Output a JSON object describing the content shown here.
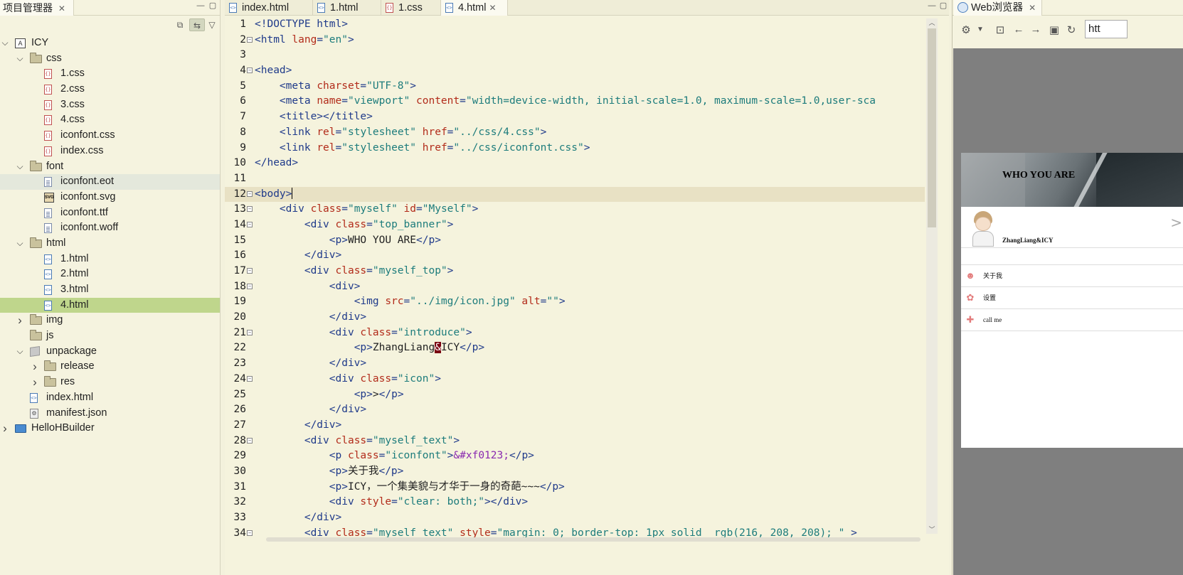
{
  "project_panel": {
    "title": "项目管理器",
    "close": "✕",
    "tree": [
      {
        "label": "ICY",
        "level": 0,
        "type": "project",
        "expanded": true
      },
      {
        "label": "css",
        "level": 1,
        "type": "folder",
        "expanded": true
      },
      {
        "label": "1.css",
        "level": 2,
        "type": "css"
      },
      {
        "label": "2.css",
        "level": 2,
        "type": "css"
      },
      {
        "label": "3.css",
        "level": 2,
        "type": "css"
      },
      {
        "label": "4.css",
        "level": 2,
        "type": "css"
      },
      {
        "label": "iconfont.css",
        "level": 2,
        "type": "css"
      },
      {
        "label": "index.css",
        "level": 2,
        "type": "css"
      },
      {
        "label": "font",
        "level": 1,
        "type": "folder",
        "expanded": true
      },
      {
        "label": "iconfont.eot",
        "level": 2,
        "type": "file",
        "state": "hover"
      },
      {
        "label": "iconfont.svg",
        "level": 2,
        "type": "svg"
      },
      {
        "label": "iconfont.ttf",
        "level": 2,
        "type": "file"
      },
      {
        "label": "iconfont.woff",
        "level": 2,
        "type": "file"
      },
      {
        "label": "html",
        "level": 1,
        "type": "folder",
        "expanded": true
      },
      {
        "label": "1.html",
        "level": 2,
        "type": "html"
      },
      {
        "label": "2.html",
        "level": 2,
        "type": "html"
      },
      {
        "label": "3.html",
        "level": 2,
        "type": "html"
      },
      {
        "label": "4.html",
        "level": 2,
        "type": "html",
        "state": "selected"
      },
      {
        "label": "img",
        "level": 1,
        "type": "folder",
        "expanded": false
      },
      {
        "label": "js",
        "level": 1,
        "type": "folder",
        "leaf": true
      },
      {
        "label": "unpackage",
        "level": 1,
        "type": "package",
        "expanded": true
      },
      {
        "label": "release",
        "level": 2,
        "type": "folder",
        "expanded": false
      },
      {
        "label": "res",
        "level": 2,
        "type": "folder",
        "expanded": false
      },
      {
        "label": "index.html",
        "level": 1,
        "type": "html"
      },
      {
        "label": "manifest.json",
        "level": 1,
        "type": "json"
      },
      {
        "label": "HelloHBuilder",
        "level": 0,
        "type": "project2",
        "expanded": false
      }
    ]
  },
  "editor": {
    "tabs": [
      {
        "label": "index.html",
        "type": "h"
      },
      {
        "label": "1.html",
        "type": "h"
      },
      {
        "label": "1.css",
        "type": "c"
      },
      {
        "label": "4.html",
        "type": "h",
        "active": true
      }
    ],
    "current_line": 12,
    "lines": [
      {
        "n": "1",
        "fold": false,
        "parts": [
          [
            "t-tag",
            "<!DOCTYPE html>"
          ]
        ]
      },
      {
        "n": "2",
        "fold": true,
        "parts": [
          [
            "t-tag",
            "<html "
          ],
          [
            "t-attr",
            "lang"
          ],
          [
            "t-tag",
            "="
          ],
          [
            "t-val",
            "\"en\""
          ],
          [
            "t-tag",
            ">"
          ]
        ]
      },
      {
        "n": "3",
        "fold": false,
        "parts": []
      },
      {
        "n": "4",
        "fold": true,
        "parts": [
          [
            "t-tag",
            "<head>"
          ]
        ]
      },
      {
        "n": "5",
        "fold": false,
        "parts": [
          [
            "t-txt",
            "    "
          ],
          [
            "t-tag",
            "<meta "
          ],
          [
            "t-attr",
            "charset"
          ],
          [
            "t-tag",
            "="
          ],
          [
            "t-val",
            "\"UTF-8\""
          ],
          [
            "t-tag",
            ">"
          ]
        ]
      },
      {
        "n": "6",
        "fold": false,
        "parts": [
          [
            "t-txt",
            "    "
          ],
          [
            "t-tag",
            "<meta "
          ],
          [
            "t-attr",
            "name"
          ],
          [
            "t-tag",
            "="
          ],
          [
            "t-val",
            "\"viewport\" "
          ],
          [
            "t-attr",
            "content"
          ],
          [
            "t-tag",
            "="
          ],
          [
            "t-val",
            "\"width=device-width, initial-scale=1.0, maximum-scale=1.0,user-sca"
          ]
        ]
      },
      {
        "n": "7",
        "fold": false,
        "parts": [
          [
            "t-txt",
            "    "
          ],
          [
            "t-tag",
            "<title></title>"
          ]
        ]
      },
      {
        "n": "8",
        "fold": false,
        "parts": [
          [
            "t-txt",
            "    "
          ],
          [
            "t-tag",
            "<link "
          ],
          [
            "t-attr",
            "rel"
          ],
          [
            "t-tag",
            "="
          ],
          [
            "t-val",
            "\"stylesheet\" "
          ],
          [
            "t-attr",
            "href"
          ],
          [
            "t-tag",
            "="
          ],
          [
            "t-val",
            "\"../css/4.css\""
          ],
          [
            "t-tag",
            ">"
          ]
        ]
      },
      {
        "n": "9",
        "fold": false,
        "parts": [
          [
            "t-txt",
            "    "
          ],
          [
            "t-tag",
            "<link "
          ],
          [
            "t-attr",
            "rel"
          ],
          [
            "t-tag",
            "="
          ],
          [
            "t-val",
            "\"stylesheet\" "
          ],
          [
            "t-attr",
            "href"
          ],
          [
            "t-tag",
            "="
          ],
          [
            "t-val",
            "\"../css/iconfont.css\""
          ],
          [
            "t-tag",
            ">"
          ]
        ]
      },
      {
        "n": "10",
        "fold": false,
        "parts": [
          [
            "t-tag",
            "</head>"
          ]
        ]
      },
      {
        "n": "11",
        "fold": false,
        "parts": []
      },
      {
        "n": "12",
        "fold": true,
        "parts": [
          [
            "t-tag",
            "<body>"
          ]
        ],
        "caret": true
      },
      {
        "n": "13",
        "fold": true,
        "parts": [
          [
            "t-txt",
            "    "
          ],
          [
            "t-tag",
            "<div "
          ],
          [
            "t-attr",
            "class"
          ],
          [
            "t-tag",
            "="
          ],
          [
            "t-val",
            "\"myself\" "
          ],
          [
            "t-attr",
            "id"
          ],
          [
            "t-tag",
            "="
          ],
          [
            "t-val",
            "\"Myself\""
          ],
          [
            "t-tag",
            ">"
          ]
        ]
      },
      {
        "n": "14",
        "fold": true,
        "parts": [
          [
            "t-txt",
            "        "
          ],
          [
            "t-tag",
            "<div "
          ],
          [
            "t-attr",
            "class"
          ],
          [
            "t-tag",
            "="
          ],
          [
            "t-val",
            "\"top_banner\""
          ],
          [
            "t-tag",
            ">"
          ]
        ]
      },
      {
        "n": "15",
        "fold": false,
        "parts": [
          [
            "t-txt",
            "            "
          ],
          [
            "t-tag",
            "<p>"
          ],
          [
            "t-txt",
            "WHO YOU ARE"
          ],
          [
            "t-tag",
            "</p>"
          ]
        ]
      },
      {
        "n": "16",
        "fold": false,
        "parts": [
          [
            "t-txt",
            "        "
          ],
          [
            "t-tag",
            "</div>"
          ]
        ]
      },
      {
        "n": "17",
        "fold": true,
        "parts": [
          [
            "t-txt",
            "        "
          ],
          [
            "t-tag",
            "<div "
          ],
          [
            "t-attr",
            "class"
          ],
          [
            "t-tag",
            "="
          ],
          [
            "t-val",
            "\"myself_top\""
          ],
          [
            "t-tag",
            ">"
          ]
        ]
      },
      {
        "n": "18",
        "fold": true,
        "parts": [
          [
            "t-txt",
            "            "
          ],
          [
            "t-tag",
            "<div>"
          ]
        ]
      },
      {
        "n": "19",
        "fold": false,
        "parts": [
          [
            "t-txt",
            "                "
          ],
          [
            "t-tag",
            "<img "
          ],
          [
            "t-attr",
            "src"
          ],
          [
            "t-tag",
            "="
          ],
          [
            "t-val",
            "\"../img/icon.jpg\" "
          ],
          [
            "t-attr",
            "alt"
          ],
          [
            "t-tag",
            "="
          ],
          [
            "t-val",
            "\"\""
          ],
          [
            "t-tag",
            ">"
          ]
        ]
      },
      {
        "n": "20",
        "fold": false,
        "parts": [
          [
            "t-txt",
            "            "
          ],
          [
            "t-tag",
            "</div>"
          ]
        ]
      },
      {
        "n": "21",
        "fold": true,
        "parts": [
          [
            "t-txt",
            "            "
          ],
          [
            "t-tag",
            "<div "
          ],
          [
            "t-attr",
            "class"
          ],
          [
            "t-tag",
            "="
          ],
          [
            "t-val",
            "\"introduce\""
          ],
          [
            "t-tag",
            ">"
          ]
        ]
      },
      {
        "n": "22",
        "fold": false,
        "parts": [
          [
            "t-txt",
            "                "
          ],
          [
            "t-tag",
            "<p>"
          ],
          [
            "t-txt",
            "ZhangLiang"
          ],
          [
            "t-hl",
            "&"
          ],
          [
            "t-txt",
            "ICY"
          ],
          [
            "t-tag",
            "</p>"
          ]
        ]
      },
      {
        "n": "23",
        "fold": false,
        "parts": [
          [
            "t-txt",
            "            "
          ],
          [
            "t-tag",
            "</div>"
          ]
        ]
      },
      {
        "n": "24",
        "fold": true,
        "parts": [
          [
            "t-txt",
            "            "
          ],
          [
            "t-tag",
            "<div "
          ],
          [
            "t-attr",
            "class"
          ],
          [
            "t-tag",
            "="
          ],
          [
            "t-val",
            "\"icon\""
          ],
          [
            "t-tag",
            ">"
          ]
        ]
      },
      {
        "n": "25",
        "fold": false,
        "parts": [
          [
            "t-txt",
            "                "
          ],
          [
            "t-tag",
            "<p>"
          ],
          [
            "t-txt",
            ">"
          ],
          [
            "t-tag",
            "</p>"
          ]
        ]
      },
      {
        "n": "26",
        "fold": false,
        "parts": [
          [
            "t-txt",
            "            "
          ],
          [
            "t-tag",
            "</div>"
          ]
        ]
      },
      {
        "n": "27",
        "fold": false,
        "parts": [
          [
            "t-txt",
            "        "
          ],
          [
            "t-tag",
            "</div>"
          ]
        ]
      },
      {
        "n": "28",
        "fold": true,
        "parts": [
          [
            "t-txt",
            "        "
          ],
          [
            "t-tag",
            "<div "
          ],
          [
            "t-attr",
            "class"
          ],
          [
            "t-tag",
            "="
          ],
          [
            "t-val",
            "\"myself_text\""
          ],
          [
            "t-tag",
            ">"
          ]
        ]
      },
      {
        "n": "29",
        "fold": false,
        "parts": [
          [
            "t-txt",
            "            "
          ],
          [
            "t-tag",
            "<p "
          ],
          [
            "t-attr",
            "class"
          ],
          [
            "t-tag",
            "="
          ],
          [
            "t-val",
            "\"iconfont\""
          ],
          [
            "t-tag",
            ">"
          ],
          [
            "t-ent",
            "&#xf0123;"
          ],
          [
            "t-tag",
            "</p>"
          ]
        ]
      },
      {
        "n": "30",
        "fold": false,
        "parts": [
          [
            "t-txt",
            "            "
          ],
          [
            "t-tag",
            "<p>"
          ],
          [
            "t-txt",
            "关于我"
          ],
          [
            "t-tag",
            "</p>"
          ]
        ]
      },
      {
        "n": "31",
        "fold": false,
        "parts": [
          [
            "t-txt",
            "            "
          ],
          [
            "t-tag",
            "<p>"
          ],
          [
            "t-txt",
            "ICY，一个集美貌与才华于一身的奇葩~~~"
          ],
          [
            "t-tag",
            "</p>"
          ]
        ]
      },
      {
        "n": "32",
        "fold": false,
        "parts": [
          [
            "t-txt",
            "            "
          ],
          [
            "t-tag",
            "<div "
          ],
          [
            "t-attr",
            "style"
          ],
          [
            "t-tag",
            "="
          ],
          [
            "t-val",
            "\"clear: both;\""
          ],
          [
            "t-tag",
            "></div>"
          ]
        ]
      },
      {
        "n": "33",
        "fold": false,
        "parts": [
          [
            "t-txt",
            "        "
          ],
          [
            "t-tag",
            "</div>"
          ]
        ]
      },
      {
        "n": "34",
        "fold": true,
        "parts": [
          [
            "t-txt",
            "        "
          ],
          [
            "t-tag",
            "<div "
          ],
          [
            "t-attr",
            "class"
          ],
          [
            "t-tag",
            "="
          ],
          [
            "t-val",
            "\"myself_text\" "
          ],
          [
            "t-attr",
            "style"
          ],
          [
            "t-tag",
            "="
          ],
          [
            "t-val",
            "\"margin: 0; border-top: 1px solid  rgb(216, 208, 208); \" "
          ],
          [
            "t-tag",
            ">"
          ]
        ]
      }
    ]
  },
  "browser": {
    "title": "Web浏览器",
    "close": "✕",
    "url": "htt",
    "page": {
      "banner_text": "WHO YOU ARE",
      "name": "ZhangLiang&ICY",
      "chevron": ">",
      "menu": [
        {
          "icon": "smile-icon",
          "glyph": "☻",
          "label": "关于我"
        },
        {
          "icon": "gear-icon",
          "glyph": "✿",
          "label": "设置"
        },
        {
          "icon": "plus-icon",
          "glyph": "✚",
          "label": "call me"
        }
      ]
    }
  },
  "colors": {
    "panel_bg": "#f5f3df",
    "selection": "#bfd68c",
    "current_line": "#e8e1c4",
    "tag": "#1f3a8a",
    "attr": "#b22b1a",
    "value": "#1d7c7c"
  }
}
